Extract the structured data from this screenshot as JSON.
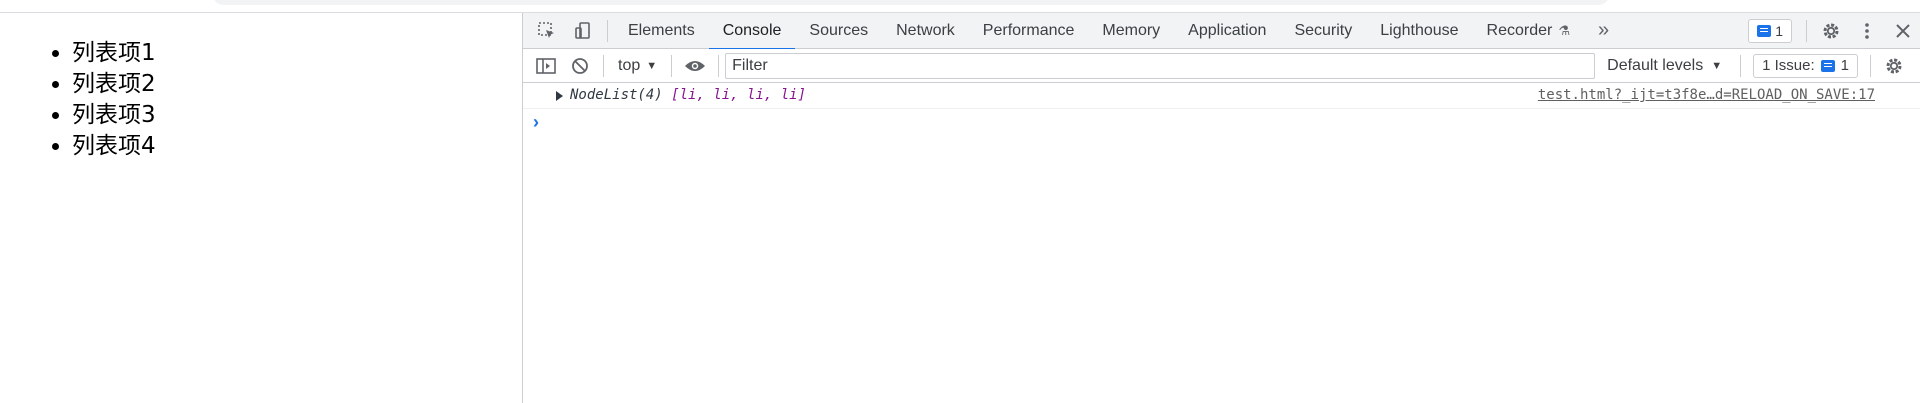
{
  "page": {
    "list_items": [
      "列表项1",
      "列表项2",
      "列表项3",
      "列表项4"
    ]
  },
  "devtools": {
    "toolbar_icons": {
      "inspect": "inspect-element-icon",
      "device": "device-toolbar-icon"
    },
    "tabs": [
      {
        "label": "Elements"
      },
      {
        "label": "Console",
        "active": true
      },
      {
        "label": "Sources"
      },
      {
        "label": "Network"
      },
      {
        "label": "Performance"
      },
      {
        "label": "Memory"
      },
      {
        "label": "Application"
      },
      {
        "label": "Security"
      },
      {
        "label": "Lighthouse"
      },
      {
        "label": "Recorder"
      }
    ],
    "more_tabs_label": "»",
    "issues_badge_count": "1",
    "console": {
      "context": "top",
      "filter_placeholder": "Filter",
      "levels_label": "Default levels",
      "issues_label": "1 Issue:",
      "issues_count": "1",
      "log": {
        "type_label": "NodeList(4)",
        "items_preview": "[li, li, li, li]",
        "source": "test.html?_ijt=t3f8e…d=RELOAD_ON_SAVE:17"
      },
      "prompt": "›"
    },
    "colors": {
      "accent": "#1a73e8",
      "toolbar_bg": "#f1f3f4"
    }
  }
}
